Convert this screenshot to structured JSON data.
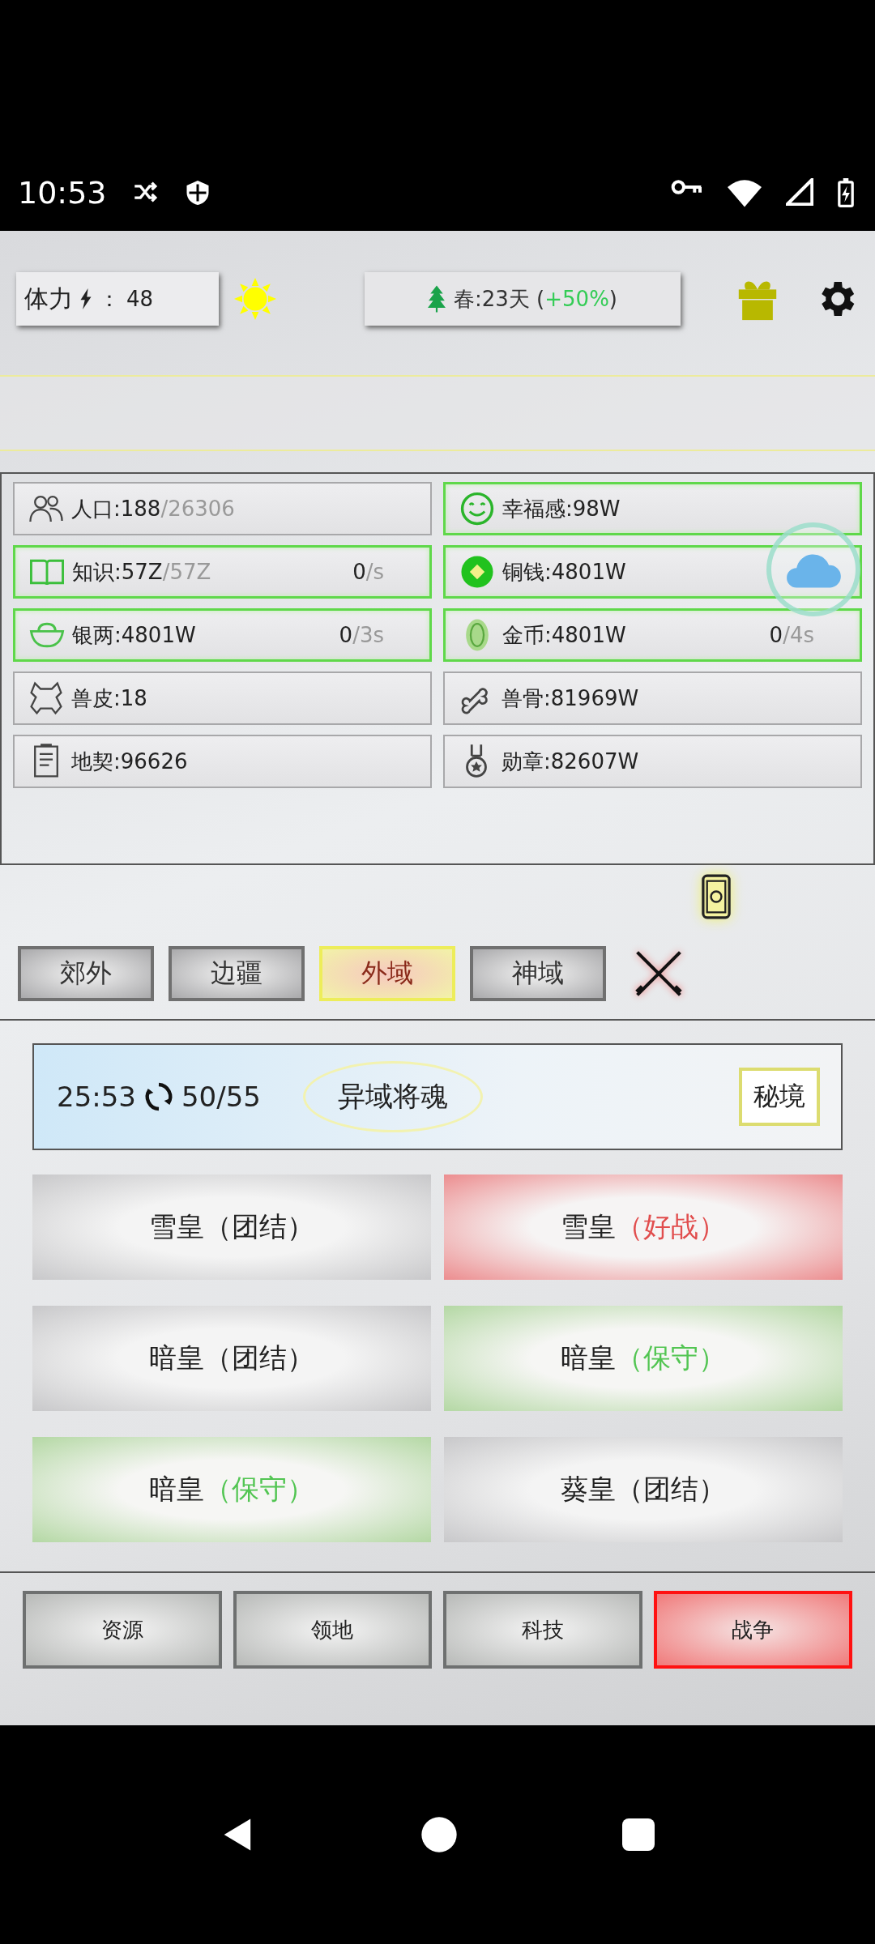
{
  "status_bar": {
    "time": "10:53"
  },
  "top_bar": {
    "stamina_label": "体力",
    "separator": "：",
    "stamina": "48",
    "season": {
      "prefix": "春:23天 (",
      "bonus": "+50%",
      "suffix": ")"
    }
  },
  "resources": [
    {
      "kind": "people",
      "label": "人口:188",
      "cap": "/26306",
      "highlighted": false
    },
    {
      "kind": "smile",
      "label": "幸福感:98W",
      "highlighted": true
    },
    {
      "kind": "book",
      "label": "知识:57Z",
      "cap": "/57Z",
      "rate": "0",
      "rate_unit": "/s",
      "highlighted": true
    },
    {
      "kind": "coin",
      "label": "铜钱:4801W",
      "highlighted": true
    },
    {
      "kind": "ingot",
      "label": "银两:4801W",
      "rate": "0",
      "rate_unit": "/3s",
      "highlighted": true
    },
    {
      "kind": "gold",
      "label": "金币:4801W",
      "rate": "0",
      "rate_unit": "/4s",
      "highlighted": true
    },
    {
      "kind": "hide",
      "label": "兽皮:18",
      "highlighted": false
    },
    {
      "kind": "bone",
      "label": "兽骨:81969W",
      "highlighted": false
    },
    {
      "kind": "deed",
      "label": "地契:96626",
      "highlighted": false
    },
    {
      "kind": "medal",
      "label": "勋章:82607W",
      "highlighted": false
    }
  ],
  "tabs": [
    {
      "label": "郊外",
      "selected": false
    },
    {
      "label": "边疆",
      "selected": false
    },
    {
      "label": "外域",
      "selected": true
    },
    {
      "label": "神域",
      "selected": false
    }
  ],
  "banner": {
    "timer": "25:53",
    "count": "50/55",
    "title": "异域将魂",
    "button": "秘境"
  },
  "generals": [
    {
      "name": "雪皇",
      "trait": "（团结）",
      "kind": "unity"
    },
    {
      "name": "雪皇",
      "trait": "（好战）",
      "kind": "warlike"
    },
    {
      "name": "暗皇",
      "trait": "（团结）",
      "kind": "unity"
    },
    {
      "name": "暗皇",
      "trait": "（保守）",
      "kind": "defensive"
    },
    {
      "name": "暗皇",
      "trait": "（保守）",
      "kind": "defensive"
    },
    {
      "name": "葵皇",
      "trait": "（团结）",
      "kind": "unity"
    }
  ],
  "bottom_nav": [
    {
      "label": "资源",
      "selected": false
    },
    {
      "label": "领地",
      "selected": false
    },
    {
      "label": "科技",
      "selected": false
    },
    {
      "label": "战争",
      "selected": true
    }
  ]
}
